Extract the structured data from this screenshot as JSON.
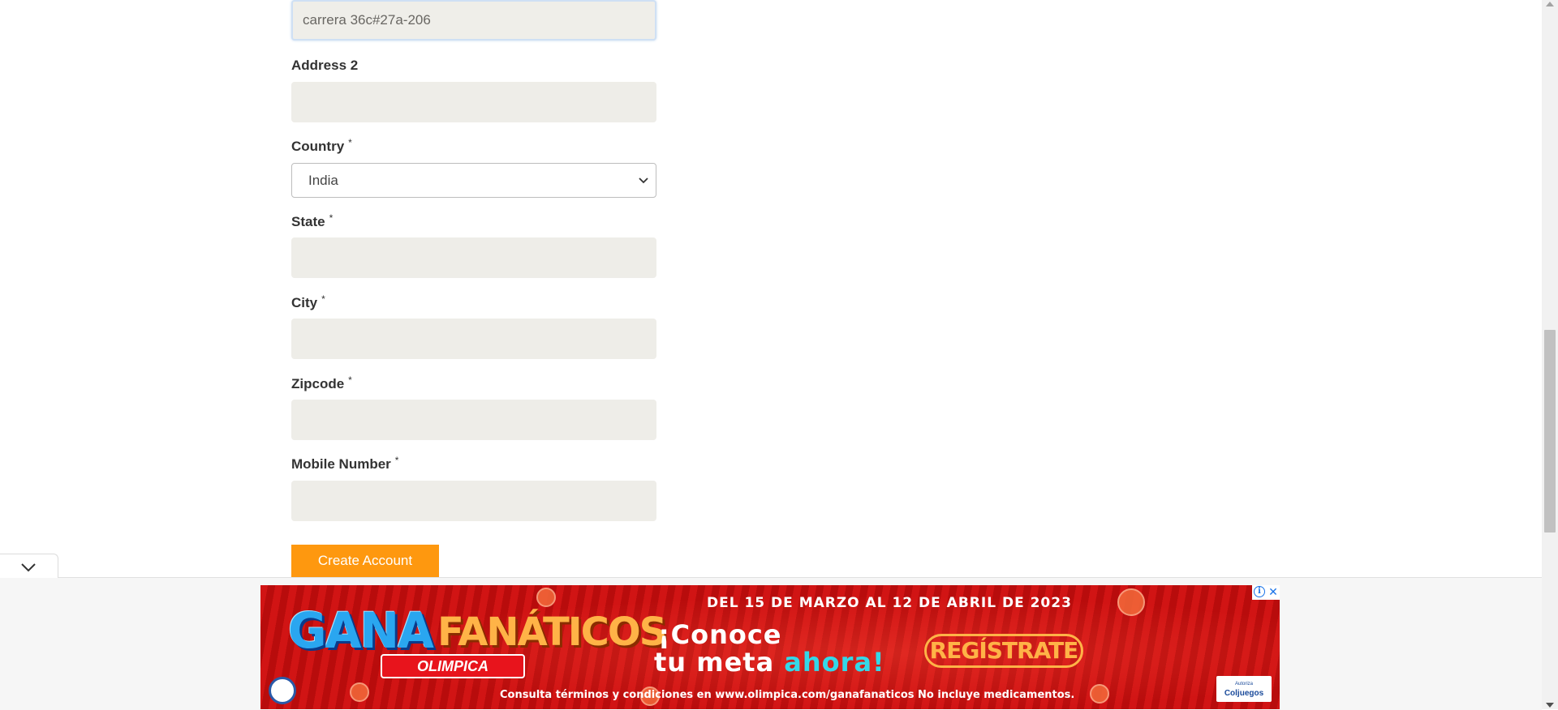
{
  "form": {
    "address1": {
      "value": "carrera 36c#27a-206"
    },
    "address2": {
      "label": "Address 2",
      "value": ""
    },
    "country": {
      "label": "Country",
      "required_mark": "*",
      "selected": "India"
    },
    "state": {
      "label": "State",
      "required_mark": "*",
      "value": ""
    },
    "city": {
      "label": "City",
      "required_mark": "*",
      "value": ""
    },
    "zipcode": {
      "label": "Zipcode",
      "required_mark": "*",
      "value": ""
    },
    "mobile": {
      "label": "Mobile Number",
      "required_mark": "*",
      "value": ""
    },
    "submit_label": "Create Account"
  },
  "ad": {
    "brand_part1": "GANA",
    "brand_part2": "FANÁTICOS",
    "retailer": "OLIMPICA",
    "date_range": "DEL 15 DE MARZO AL 12 DE ABRIL DE 2023",
    "headline_line1": "¡Conoce",
    "headline_line2_prefix": "tu meta",
    "headline_line2_accent": "ahora!",
    "cta": "REGÍSTRATE",
    "disclaimer": "Consulta términos y condiciones en www.olimpica.com/ganafanaticos No incluye medicamentos.",
    "regulator_small": "Autoriza",
    "regulator": "Coljuegos",
    "info_icon": "info-icon",
    "close_icon": "close-icon"
  },
  "icons": {
    "collapse": "chevron-down-icon",
    "select": "chevron-down-icon"
  },
  "colors": {
    "button_bg": "#fe980f",
    "input_bg": "#eeede8",
    "ad_red": "#d11414",
    "ad_accent_cyan": "#34d8e8",
    "ad_accent_orange": "#ffb347"
  }
}
